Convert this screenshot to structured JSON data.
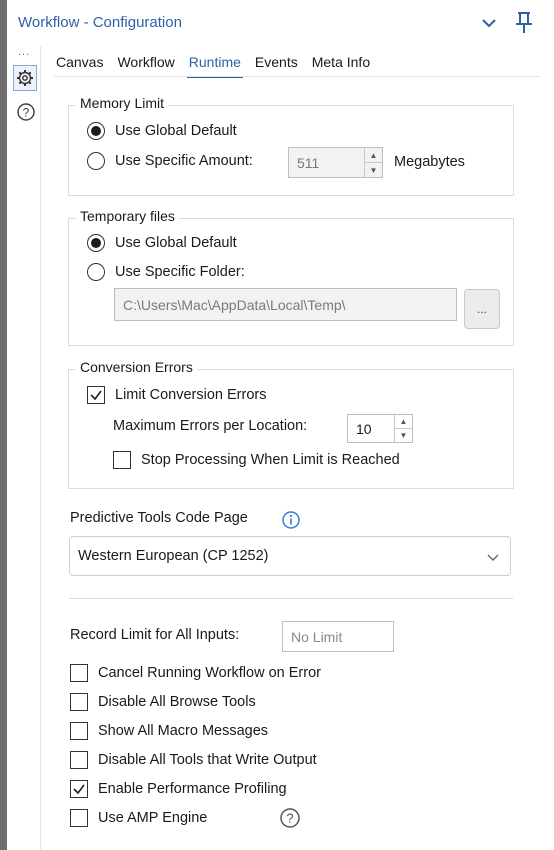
{
  "window": {
    "title": "Workflow - Configuration"
  },
  "sidebar": {
    "more": "..."
  },
  "tabs": [
    {
      "label": "Canvas"
    },
    {
      "label": "Workflow"
    },
    {
      "label": "Runtime"
    },
    {
      "label": "Events"
    },
    {
      "label": "Meta Info"
    }
  ],
  "memory": {
    "title": "Memory Limit",
    "global_label": "Use Global Default",
    "specific_label": "Use Specific Amount:",
    "amount": "511",
    "unit": "Megabytes",
    "selected": "global"
  },
  "temp": {
    "title": "Temporary files",
    "global_label": "Use Global Default",
    "specific_label": "Use Specific Folder:",
    "folder": "C:\\Users\\Mac\\AppData\\Local\\Temp\\",
    "browse_label": "...",
    "selected": "global"
  },
  "conversion": {
    "title": "Conversion Errors",
    "limit_label": "Limit Conversion Errors",
    "limit_checked": true,
    "max_label": "Maximum Errors per Location:",
    "max_value": "10",
    "stop_label": "Stop Processing When Limit is Reached",
    "stop_checked": false
  },
  "predictive": {
    "label": "Predictive Tools Code Page",
    "value": "Western European (CP 1252)"
  },
  "record_limit": {
    "label": "Record Limit for All Inputs:",
    "placeholder": "No Limit"
  },
  "options": [
    {
      "label": "Cancel Running Workflow on Error",
      "checked": false
    },
    {
      "label": "Disable All Browse Tools",
      "checked": false
    },
    {
      "label": "Show All Macro Messages",
      "checked": false
    },
    {
      "label": "Disable All Tools that Write Output",
      "checked": false
    },
    {
      "label": "Enable Performance Profiling",
      "checked": true
    },
    {
      "label": "Use AMP Engine",
      "checked": false
    }
  ],
  "colors": {
    "accent": "#2f5fa5",
    "info": "#2f7fd1"
  }
}
